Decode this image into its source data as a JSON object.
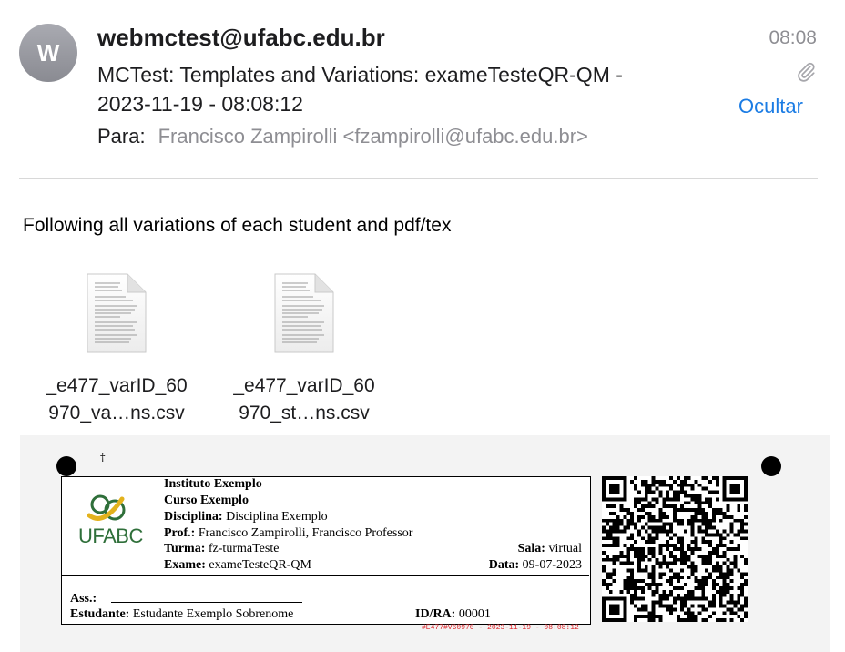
{
  "email": {
    "avatar_initial": "W",
    "sender": "webmctest@ufabc.edu.br",
    "time": "08:08",
    "subject_line1": "MCTest: Templates and Variations: exameTesteQR-QM -",
    "subject_line2": "2023-11-19 - 08:08:12",
    "hide_label": "Ocultar",
    "to_label": "Para:",
    "to_value": "Francisco Zampirolli <fzampirolli@ufabc.edu.br>",
    "body": "Following all variations of each student and pdf/tex",
    "accent_color": "#1b7ce4"
  },
  "attachments": [
    {
      "name_line1": "_e477_varID_60",
      "name_line2": "970_va…ns.csv",
      "icon": "document-icon"
    },
    {
      "name_line1": "_e477_varID_60",
      "name_line2": "970_st…ns.csv",
      "icon": "document-icon"
    }
  ],
  "preview": {
    "dagger": "†",
    "logo_text": "UFABC",
    "institute": "Instituto Exemplo",
    "course": "Curso Exemplo",
    "discipline_label": "Disciplina:",
    "discipline_value": "Disciplina Exemplo",
    "prof_label": "Prof.:",
    "prof_value": "Francisco Zampirolli, Francisco Professor",
    "turma_label": "Turma:",
    "turma_value": "fz-turmaTeste",
    "sala_label": "Sala:",
    "sala_value": "virtual",
    "exam_label": "Exame:",
    "exam_value": "exameTesteQR-QM",
    "date_label": "Data:",
    "date_value": "09-07-2023",
    "signature_label": "Ass.:",
    "student_label": "Estudante:",
    "student_value": "Estudante Exemplo Sobrenome",
    "id_label": "ID/RA:",
    "id_value": "00001",
    "footer_code": "#E477#V60970 - 2023-11-19 - 08:08:12"
  }
}
